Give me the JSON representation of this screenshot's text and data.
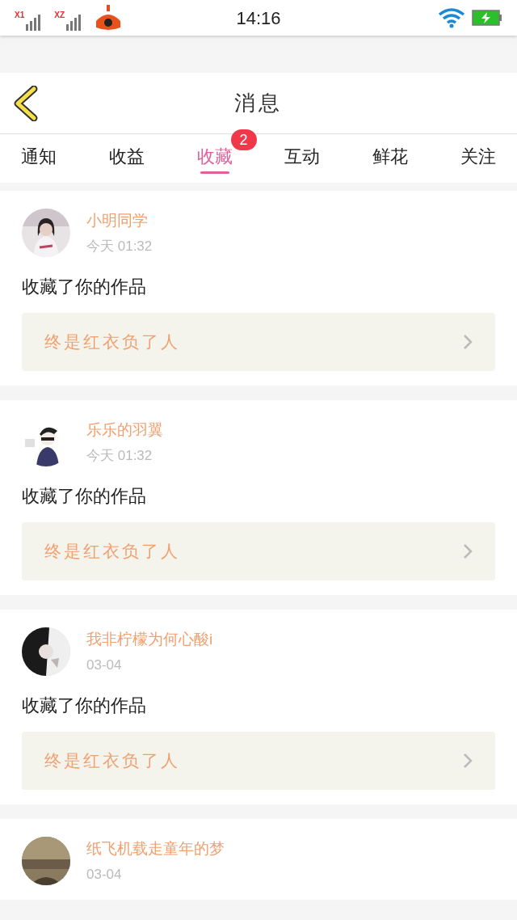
{
  "status_bar": {
    "sim_1": "X1",
    "sim_2": "XZ",
    "time": "14:16"
  },
  "header": {
    "title": "消息"
  },
  "tabs": [
    {
      "label": "通知",
      "selected": false
    },
    {
      "label": "收益",
      "selected": false
    },
    {
      "label": "收藏",
      "selected": true,
      "badge": "2"
    },
    {
      "label": "互动",
      "selected": false
    },
    {
      "label": "鲜花",
      "selected": false
    },
    {
      "label": "关注",
      "selected": false
    }
  ],
  "messages": [
    {
      "name": "小明同学",
      "time": "今天 01:32",
      "action": "收藏了你的作品",
      "work": "终是红衣负了人"
    },
    {
      "name": "乐乐的羽翼",
      "time": "今天 01:32",
      "action": "收藏了你的作品",
      "work": "终是红衣负了人"
    },
    {
      "name": "我非柠檬为何心酸i",
      "time": "03-04",
      "action": "收藏了你的作品",
      "work": "终是红衣负了人"
    },
    {
      "name": "纸飞机载走童年的梦",
      "time": "03-04"
    }
  ]
}
